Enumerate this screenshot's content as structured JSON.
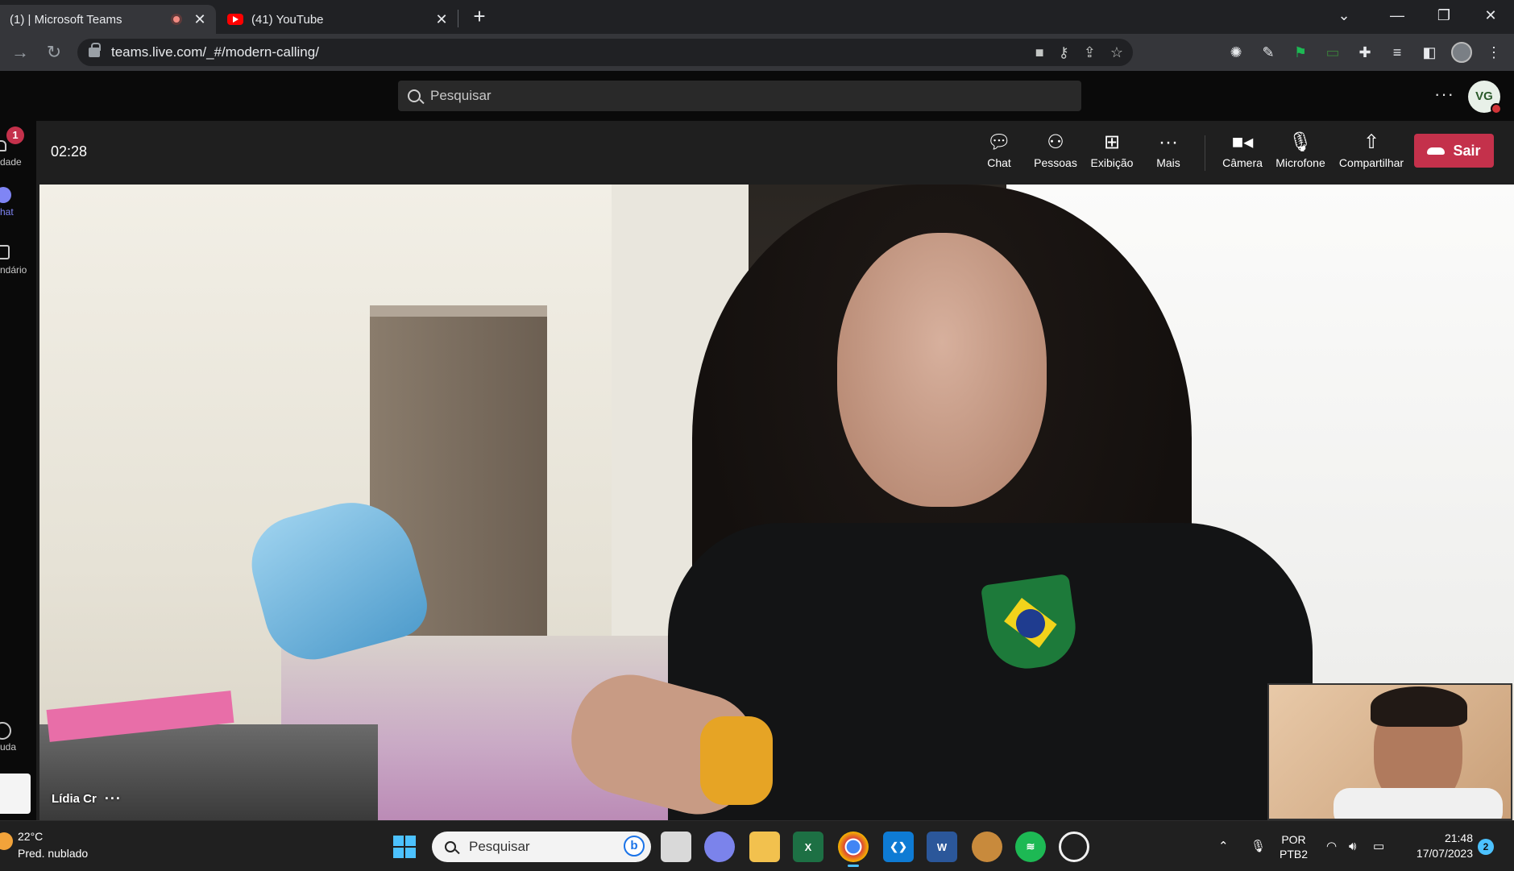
{
  "browser": {
    "tabs": [
      {
        "title": "(1) | Microsoft Teams",
        "active": true,
        "recording": true
      },
      {
        "title": "(41) YouTube",
        "active": false
      }
    ],
    "new_tab_symbol": "+",
    "window_controls": {
      "dropdown": "⌄",
      "minimize": "—",
      "restore": "❐",
      "close": "✕"
    },
    "url": "teams.live.com/_#/modern-calling/"
  },
  "teams": {
    "search_placeholder": "Pesquisar",
    "more": "···",
    "user_initials": "VG",
    "status_color": "#d13438"
  },
  "rail": {
    "items": [
      {
        "label": "dade",
        "badge": "1",
        "icon": "bell-icon"
      },
      {
        "label": "hat",
        "icon": "chat-icon"
      },
      {
        "label": "ndário",
        "icon": "calendar-icon"
      },
      {
        "label": "uda",
        "icon": "help-icon"
      }
    ]
  },
  "meeting": {
    "timer": "02:28",
    "controls": [
      {
        "label": "Chat",
        "icon": "chat-bubble-icon"
      },
      {
        "label": "Pessoas",
        "icon": "people-icon"
      },
      {
        "label": "Exibição",
        "icon": "layout-grid-icon"
      },
      {
        "label": "Mais",
        "icon": "more-dots-icon"
      },
      {
        "label": "Câmera",
        "icon": "camera-icon"
      },
      {
        "label": "Microfone",
        "icon": "microphone-icon"
      },
      {
        "label": "Compartilhar",
        "icon": "share-tray-icon"
      }
    ],
    "leave_label": "Sair",
    "leave_color": "#c4314b",
    "participant_name": "Lídia Cr",
    "participant_more": "···"
  },
  "taskbar": {
    "weather_temp": "22°C",
    "weather_desc": "Pred. nublado",
    "search_placeholder": "Pesquisar",
    "lang_top": "POR",
    "lang_bottom": "PTB2",
    "time": "21:48",
    "date": "17/07/2023",
    "notifications": "2",
    "apps": [
      {
        "name": "task-view",
        "color": "#d9d9d9"
      },
      {
        "name": "teams-chat",
        "color": "#7b83eb"
      },
      {
        "name": "file-explorer",
        "color": "#f2c14e"
      },
      {
        "name": "excel",
        "color": "#1d7044",
        "glyph": "X"
      },
      {
        "name": "chrome",
        "color": "#4285f4"
      },
      {
        "name": "vscode",
        "color": "#0e7bd4"
      },
      {
        "name": "word",
        "color": "#2b579a",
        "glyph": "W"
      },
      {
        "name": "game",
        "color": "#c88a3c"
      },
      {
        "name": "spotify",
        "color": "#1db954"
      },
      {
        "name": "obs",
        "color": "#f0f0f0"
      }
    ]
  }
}
